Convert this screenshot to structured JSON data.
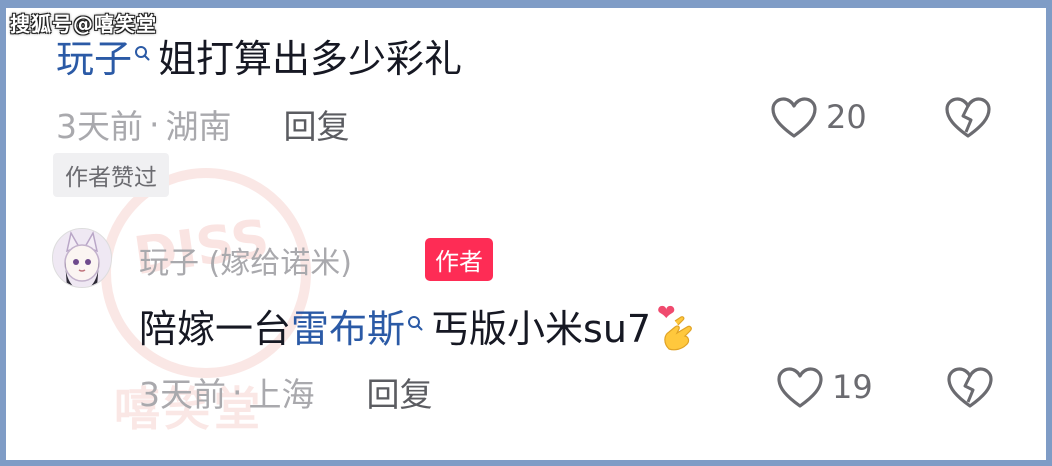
{
  "watermark": "搜狐号@嘻笑堂",
  "comment1": {
    "mention": "玩子",
    "text": "姐打算出多少彩礼",
    "time": "3天前",
    "location": "湖南",
    "separator": "·",
    "reply_label": "回复",
    "likes": "20",
    "author_liked_badge": "作者赞过"
  },
  "comment2": {
    "author_name": "玩子 (嫁给诺米)",
    "author_badge": "作者",
    "text_before": "陪嫁一台",
    "mention": "雷布斯",
    "text_after": "丐版小米su7",
    "emoji": "🫰",
    "time": "3天前",
    "location": "上海",
    "separator": "·",
    "reply_label": "回复",
    "likes": "19"
  },
  "stamp": {
    "top_text": "DISS",
    "bottom_text": "嘻笑堂"
  },
  "colors": {
    "link": "#2b5aa6",
    "author_badge": "#fe2c55",
    "frame": "#7f9cc6"
  }
}
